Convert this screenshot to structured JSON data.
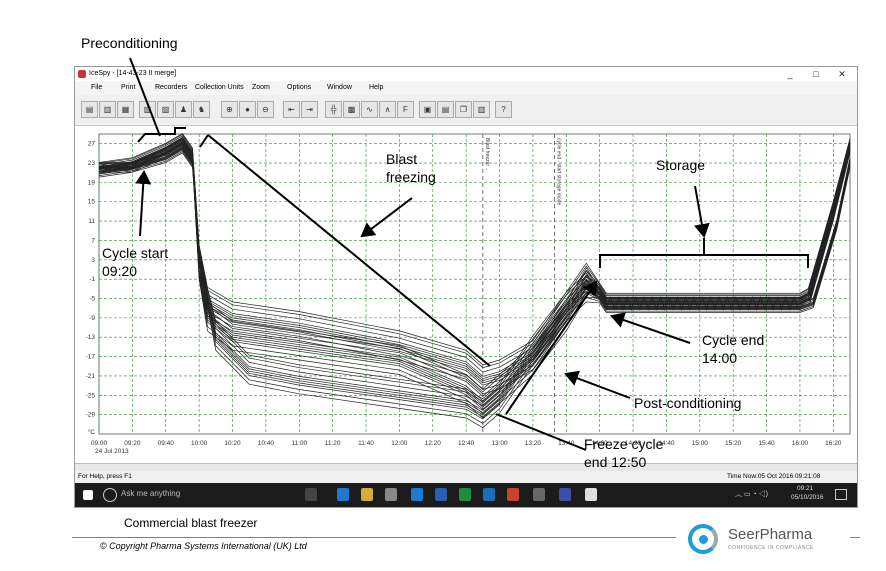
{
  "window": {
    "title": "IceSpy - [14-43-23 II merge]",
    "menu": [
      "File",
      "Print",
      "Recorders",
      "Collection Units",
      "Zoom",
      "Options",
      "Window",
      "Help"
    ],
    "min": "_",
    "max": "□",
    "close": "✕"
  },
  "status": {
    "left": "For Help, press F1",
    "right": "Time Now:05 Oct 2016 09:21:08"
  },
  "taskbar": {
    "search": "Ask me anything",
    "time": "09:21",
    "date": "05/10/2016"
  },
  "chart_data": {
    "type": "line",
    "y_ticks": [
      "27",
      "23",
      "19",
      "15",
      "11",
      "7",
      "3",
      "-1",
      "-5",
      "-9",
      "-13",
      "-17",
      "-21",
      "-25",
      "-29",
      "°C"
    ],
    "x_ticks": [
      "09:00",
      "09:20",
      "09:40",
      "10:00",
      "10:20",
      "10:40",
      "11:00",
      "11:20",
      "11:40",
      "12:00",
      "12:20",
      "12:40",
      "13:00",
      "13:20",
      "13:40",
      "14:00",
      "14:20",
      "14:40",
      "15:00",
      "15:20",
      "15:40",
      "16:00",
      "16:20"
    ],
    "x_date": "24 Jul 2013",
    "ylim": [
      -33,
      29
    ],
    "markers": [
      "Blast freezer ...",
      "cycle end - start storage mode"
    ],
    "representative_series": [
      [
        [
          "09:00",
          22
        ],
        [
          "09:20",
          22
        ],
        [
          "09:40",
          25
        ],
        [
          "09:50",
          27
        ],
        [
          "09:56",
          24
        ],
        [
          "10:00",
          0
        ],
        [
          "10:05",
          -9
        ],
        [
          "10:20",
          -13
        ],
        [
          "11:00",
          -15
        ],
        [
          "12:00",
          -18
        ],
        [
          "12:40",
          -24
        ],
        [
          "12:50",
          -27
        ],
        [
          "13:00",
          -24
        ],
        [
          "13:20",
          -18
        ],
        [
          "13:40",
          -9
        ],
        [
          "13:52",
          -2
        ],
        [
          "14:00",
          -4
        ],
        [
          "14:04",
          -6
        ],
        [
          "14:30",
          -6
        ],
        [
          "15:00",
          -6
        ],
        [
          "15:30",
          -6
        ],
        [
          "16:00",
          -6
        ],
        [
          "16:06",
          -5
        ],
        [
          "16:20",
          12
        ],
        [
          "16:30",
          26
        ]
      ],
      [
        [
          "09:00",
          21
        ],
        [
          "09:20",
          22
        ],
        [
          "09:40",
          24
        ],
        [
          "09:50",
          26
        ],
        [
          "09:56",
          23
        ],
        [
          "10:00",
          3
        ],
        [
          "10:10",
          -13
        ],
        [
          "10:30",
          -20
        ],
        [
          "11:00",
          -22
        ],
        [
          "12:00",
          -25
        ],
        [
          "12:40",
          -27
        ],
        [
          "12:50",
          -29
        ],
        [
          "13:00",
          -26
        ],
        [
          "13:20",
          -16
        ],
        [
          "13:40",
          -7
        ],
        [
          "13:52",
          -3
        ],
        [
          "14:00",
          -5
        ],
        [
          "14:04",
          -7
        ],
        [
          "14:30",
          -7
        ],
        [
          "15:00",
          -7
        ],
        [
          "15:30",
          -7
        ],
        [
          "16:00",
          -7
        ],
        [
          "16:08",
          -6
        ],
        [
          "16:22",
          10
        ],
        [
          "16:30",
          23
        ]
      ],
      [
        [
          "09:00",
          22
        ],
        [
          "09:20",
          23
        ],
        [
          "09:40",
          26
        ],
        [
          "09:50",
          28
        ],
        [
          "09:56",
          25
        ],
        [
          "10:00",
          5
        ],
        [
          "10:05",
          -6
        ],
        [
          "10:20",
          -9
        ],
        [
          "11:00",
          -11
        ],
        [
          "12:00",
          -15
        ],
        [
          "12:40",
          -19
        ],
        [
          "12:50",
          -22
        ],
        [
          "13:00",
          -21
        ],
        [
          "13:20",
          -17
        ],
        [
          "13:40",
          -7
        ],
        [
          "13:52",
          -1
        ],
        [
          "14:00",
          -3
        ],
        [
          "14:04",
          -5
        ],
        [
          "14:30",
          -5
        ],
        [
          "15:00",
          -5
        ],
        [
          "15:30",
          -5
        ],
        [
          "16:00",
          -5
        ],
        [
          "16:05",
          -4
        ],
        [
          "16:20",
          14
        ],
        [
          "16:30",
          27
        ]
      ]
    ]
  },
  "annotations": {
    "preconditioning": "Preconditioning",
    "blast_freezing": "Blast\nfreezing",
    "storage": "Storage",
    "cycle_start": "Cycle start\n09:20",
    "cycle_end": "Cycle end\n14:00",
    "post_conditioning": "Post-conditioning",
    "freeze_cycle_end": "Freeze cycle\nend 12:50"
  },
  "caption": "Commercial blast freezer",
  "copyright": "© Copyright Pharma Systems International (UK) Ltd",
  "logo": {
    "name": "SeerPharma",
    "tagline": "CONFIDENCE IN COMPLIANCE"
  },
  "colors": {
    "grid": "#2e8b2e",
    "trace": "#222222",
    "accent": "#1a9dd9"
  }
}
